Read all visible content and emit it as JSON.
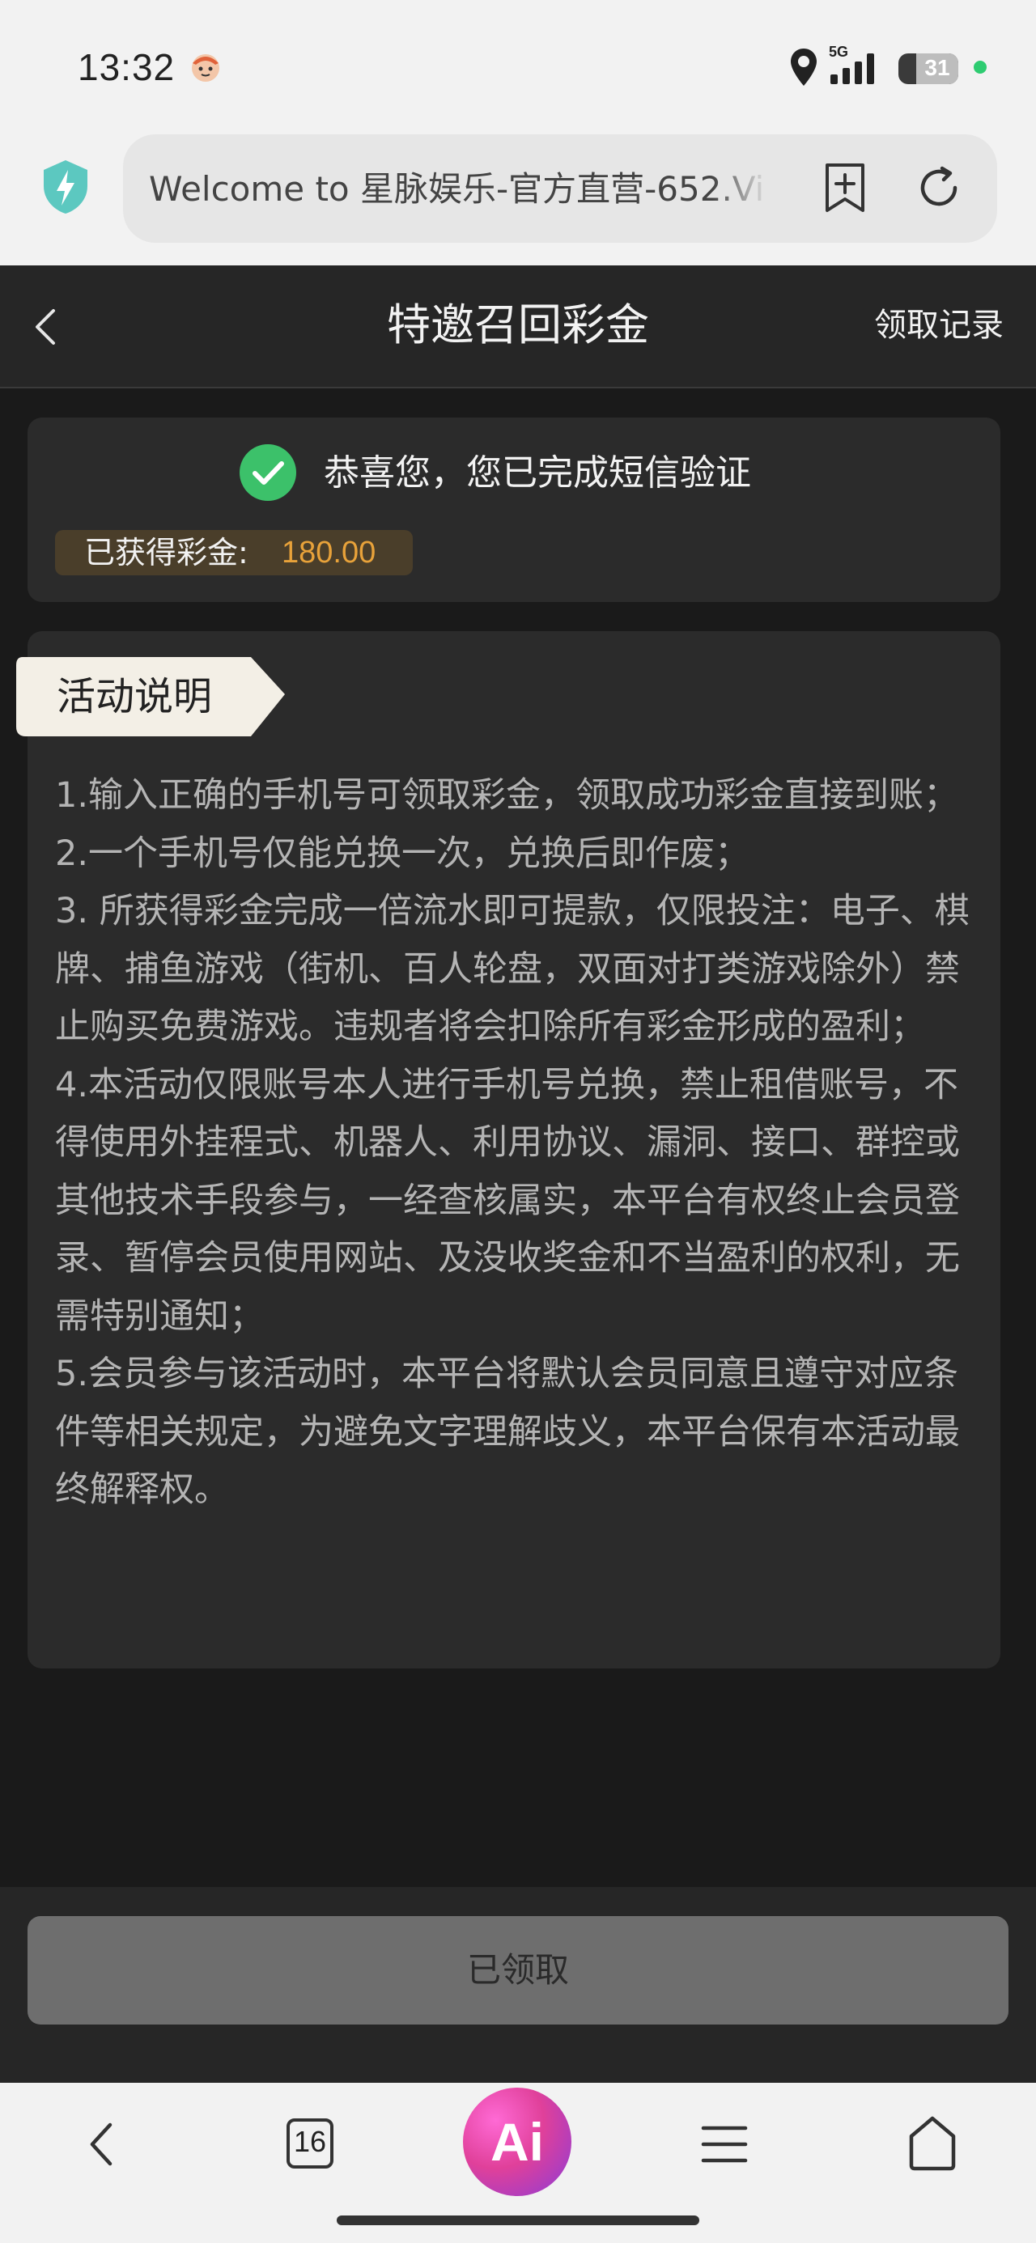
{
  "status_bar": {
    "time": "13:32",
    "network": "5G",
    "battery": "31"
  },
  "browser": {
    "url_text": "Welcome to 星脉娱乐-官方直营-652.Vip",
    "tab_count": "16",
    "ai_label": "Ai"
  },
  "header": {
    "title": "特邀召回彩金",
    "records_link": "领取记录"
  },
  "success_card": {
    "message": "恭喜您，您已完成短信验证",
    "bonus_label": "已获得彩金:",
    "bonus_value": "180.00"
  },
  "description": {
    "tag": "活动说明",
    "rules": [
      "1.输入正确的手机号可领取彩金，领取成功彩金直接到账；",
      "2.一个手机号仅能兑换一次，兑换后即作废；",
      "3. 所获得彩金完成一倍流水即可提款，仅限投注：电子、棋牌、捕鱼游戏（街机、百人轮盘，双面对打类游戏除外）禁止购买免费游戏。违规者将会扣除所有彩金形成的盈利；",
      "4.本活动仅限账号本人进行手机号兑换，禁止租借账号，不得使用外挂程式、机器人、利用协议、漏洞、接口、群控或其他技术手段参与，一经查核属实，本平台有权终止会员登录、暂停会员使用网站、及没收奖金和不当盈利的权利，无需特别通知；",
      "5.会员参与该活动时，本平台将默认会员同意且遵守对应条件等相关规定，为避免文字理解歧义，本平台保有本活动最终解释权。"
    ]
  },
  "action": {
    "claimed_label": "已领取"
  },
  "colors": {
    "page_bg": "#1a1a1a",
    "card_bg": "#2b2b2b",
    "bonus_accent": "#e8a23a",
    "check_green": "#3cc16a",
    "shield_teal": "#5cc8c0"
  }
}
